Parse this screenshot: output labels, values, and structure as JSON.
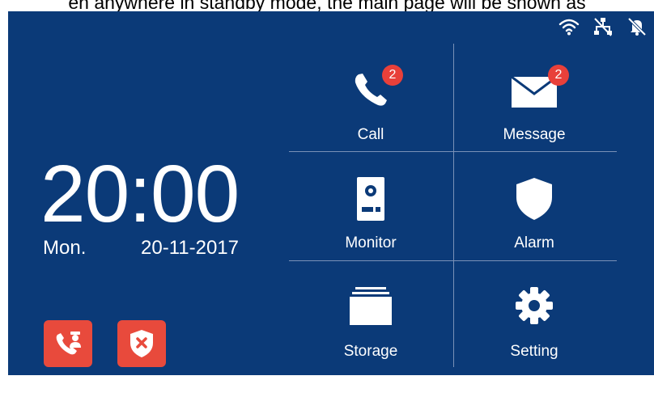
{
  "caption": "en anywhere in standby mode, the main page will be shown as",
  "status": {
    "icons": [
      "wifi-icon",
      "network-icon",
      "mute-bell-icon"
    ]
  },
  "clock": {
    "time": "20:00",
    "day": "Mon.",
    "date": "20-11-2017"
  },
  "quick_actions": [
    {
      "name": "call-guard",
      "icon": "phone-guard-icon"
    },
    {
      "name": "disarm-alarm",
      "icon": "shield-x-icon"
    }
  ],
  "tiles": [
    {
      "label": "Call",
      "icon": "phone-icon",
      "badge": "2"
    },
    {
      "label": "Message",
      "icon": "envelope-icon",
      "badge": "2"
    },
    {
      "label": "Monitor",
      "icon": "door-station-icon"
    },
    {
      "label": "Alarm",
      "icon": "shield-icon"
    },
    {
      "label": "Storage",
      "icon": "folder-icon"
    },
    {
      "label": "Setting",
      "icon": "gear-icon"
    }
  ],
  "colors": {
    "background": "#0b3a78",
    "accent": "#e84a3c",
    "badge": "#e8403a",
    "text": "#ffffff"
  }
}
